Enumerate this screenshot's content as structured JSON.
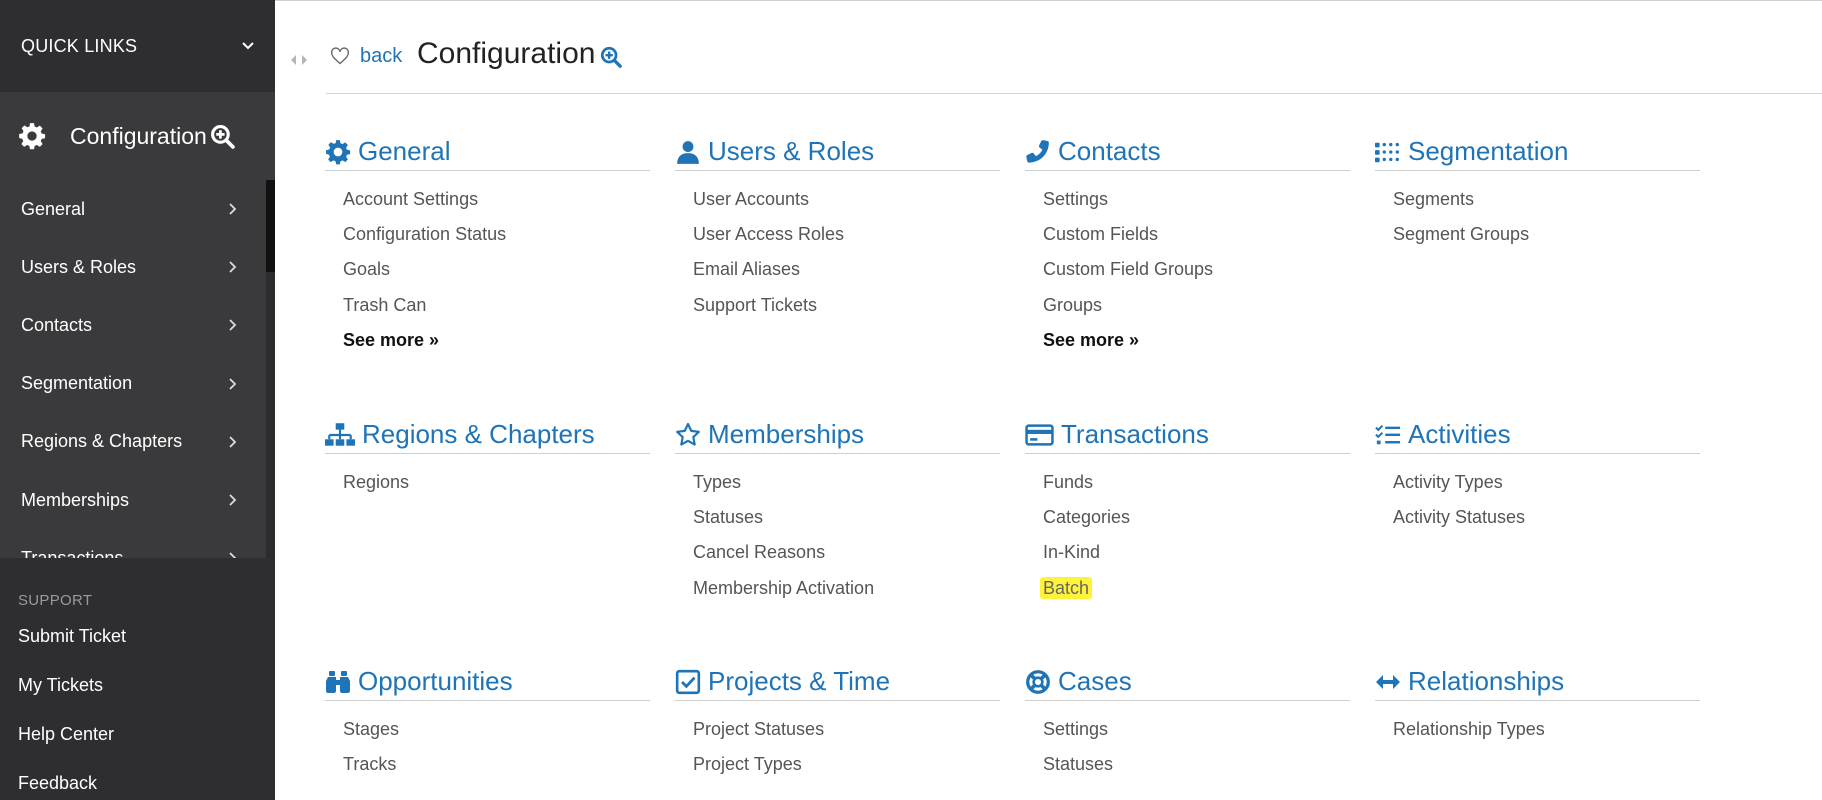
{
  "colors": {
    "accent": "#1e74b6",
    "sidebar": "#3a3a3c",
    "sidebar_dark": "#2e2e30",
    "highlight": "#fff23a"
  },
  "sidebar": {
    "quick_links": "QUICK LINKS",
    "title": "Configuration",
    "nav": [
      "General",
      "Users & Roles",
      "Contacts",
      "Segmentation",
      "Regions & Chapters",
      "Memberships",
      "Transactions"
    ],
    "support_heading": "SUPPORT",
    "support_links": [
      "Submit Ticket",
      "My Tickets",
      "Help Center",
      "Feedback"
    ]
  },
  "header": {
    "back": "back",
    "title": "Configuration"
  },
  "sections": [
    {
      "title": "General",
      "icon": "gear-icon",
      "links": [
        "Account Settings",
        "Configuration Status",
        "Goals",
        "Trash Can"
      ],
      "more": "See more »"
    },
    {
      "title": "Users & Roles",
      "icon": "user-icon",
      "links": [
        "User Accounts",
        "User Access Roles",
        "Email Aliases",
        "Support Tickets"
      ]
    },
    {
      "title": "Contacts",
      "icon": "phone-icon",
      "links": [
        "Settings",
        "Custom Fields",
        "Custom Field Groups",
        "Groups"
      ],
      "more": "See more »"
    },
    {
      "title": "Segmentation",
      "icon": "dots-grid-icon",
      "links": [
        "Segments",
        "Segment Groups"
      ]
    },
    {
      "title": "Regions & Chapters",
      "icon": "sitemap-icon",
      "links": [
        "Regions"
      ]
    },
    {
      "title": "Memberships",
      "icon": "star-icon",
      "links": [
        "Types",
        "Statuses",
        "Cancel Reasons",
        "Membership Activation"
      ]
    },
    {
      "title": "Transactions",
      "icon": "credit-card-icon",
      "links": [
        "Funds",
        "Categories",
        "In-Kind",
        "Batch"
      ]
    },
    {
      "title": "Activities",
      "icon": "checklist-icon",
      "links": [
        "Activity Types",
        "Activity Statuses"
      ]
    },
    {
      "title": "Opportunities",
      "icon": "binoculars-icon",
      "links": [
        "Stages",
        "Tracks"
      ]
    },
    {
      "title": "Projects & Time",
      "icon": "checkbox-icon",
      "links": [
        "Project Statuses",
        "Project Types"
      ]
    },
    {
      "title": "Cases",
      "icon": "life-ring-icon",
      "links": [
        "Settings",
        "Statuses"
      ]
    },
    {
      "title": "Relationships",
      "icon": "arrows-h-icon",
      "links": [
        "Relationship Types"
      ]
    }
  ]
}
